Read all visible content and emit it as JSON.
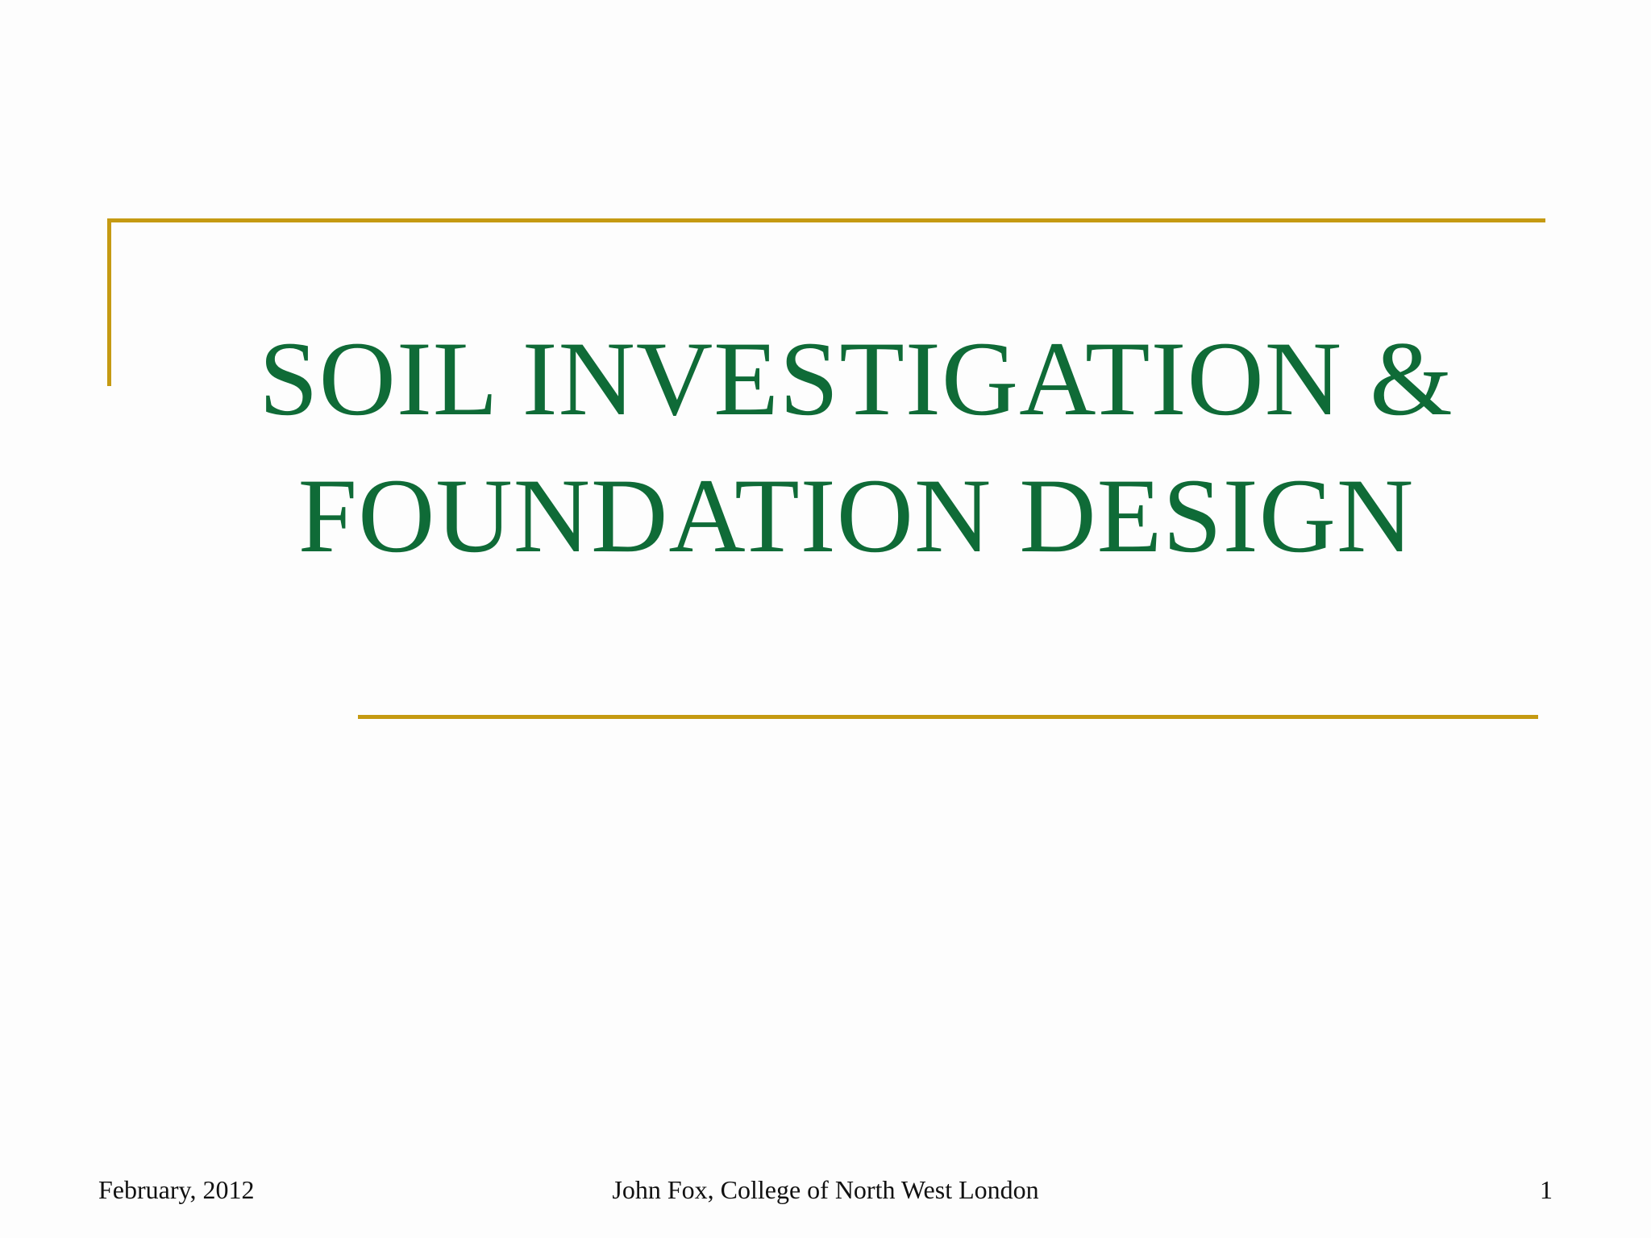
{
  "slide": {
    "title_line1": "SOIL INVESTIGATION &",
    "title_line2": "FOUNDATION DESIGN",
    "footer_date": "February, 2012",
    "footer_author": "John Fox, College of North West London",
    "page_number": "1"
  },
  "colors": {
    "title": "#0f6b37",
    "accent_rule": "#c59a12",
    "background": "#fdfdfd",
    "footer_text": "#111111"
  }
}
